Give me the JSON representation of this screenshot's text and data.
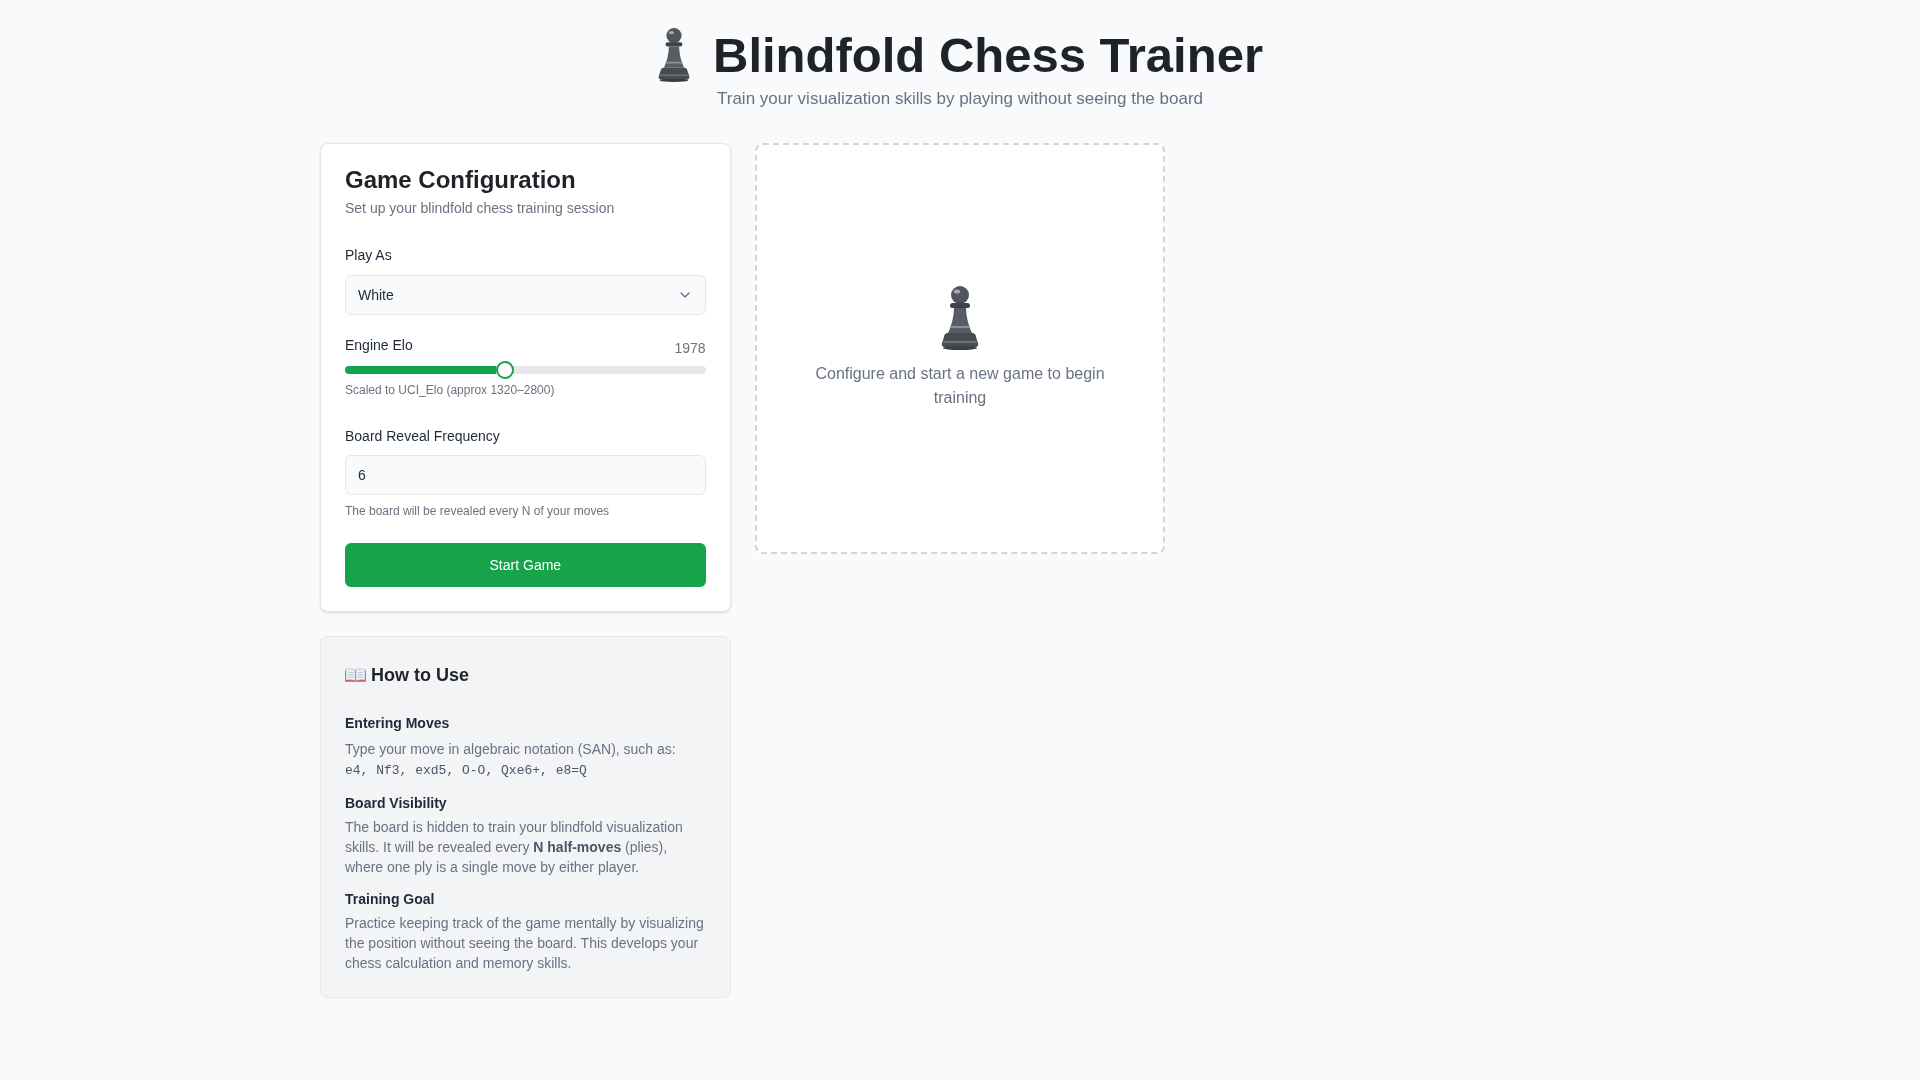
{
  "header": {
    "title": "Blindfold Chess Trainer",
    "subtitle": "Train your visualization skills by playing without seeing the board"
  },
  "config": {
    "title": "Game Configuration",
    "subtitle": "Set up your blindfold chess training session",
    "play_as": {
      "label": "Play As",
      "value": "White"
    },
    "engine_elo": {
      "label": "Engine Elo",
      "reading": "1978",
      "level": 0.445,
      "hint": "Scaled to UCI_Elo (approx 1320–2800)"
    },
    "reveal_frequency": {
      "label": "Board Reveal Frequency",
      "value": "6",
      "hint": "The board will be revealed every N of your moves"
    },
    "start_button": {
      "label": "Start Game"
    }
  },
  "how_to_use": {
    "title": "How to Use",
    "sections": [
      {
        "heading": "Entering Moves",
        "text": "Type your move in algebraic notation (SAN), such as:",
        "code": "e4, Nf3, exd5, O-O, Qxe6+, e8=Q"
      },
      {
        "heading": "Board Visibility",
        "text": "The board is hidden to train your blindfold visualization skills. It will be revealed every **N half-moves** (plies), where one ply is a single move by either player."
      },
      {
        "heading": "Training Goal",
        "text": "Practice keeping track of the game mentally by visualizing the position without seeing the board. This develops your chess calculation and memory skills."
      }
    ]
  },
  "game_panel": {
    "message": "Configure and start a new game to begin training"
  }
}
